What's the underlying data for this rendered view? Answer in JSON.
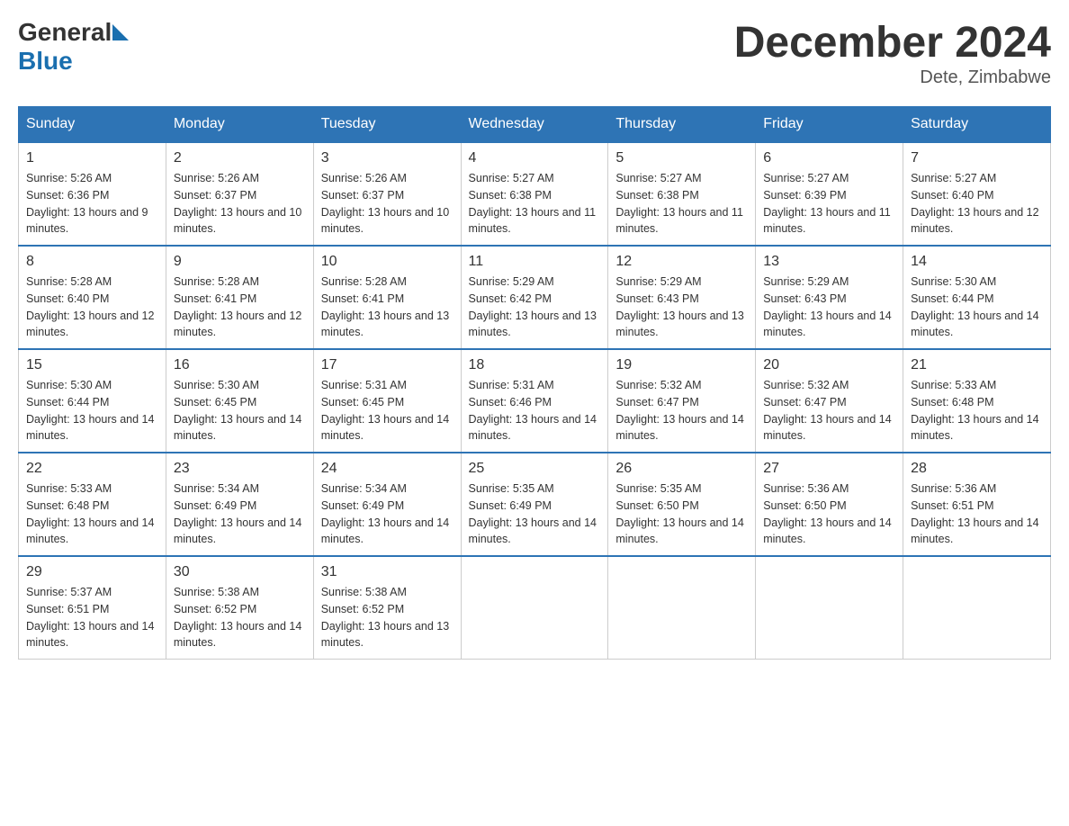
{
  "header": {
    "logo": {
      "general": "General",
      "blue": "Blue"
    },
    "title": "December 2024",
    "subtitle": "Dete, Zimbabwe"
  },
  "calendar": {
    "days_of_week": [
      "Sunday",
      "Monday",
      "Tuesday",
      "Wednesday",
      "Thursday",
      "Friday",
      "Saturday"
    ],
    "weeks": [
      [
        {
          "day": 1,
          "sunrise": "5:26 AM",
          "sunset": "6:36 PM",
          "daylight": "13 hours and 9 minutes."
        },
        {
          "day": 2,
          "sunrise": "5:26 AM",
          "sunset": "6:37 PM",
          "daylight": "13 hours and 10 minutes."
        },
        {
          "day": 3,
          "sunrise": "5:26 AM",
          "sunset": "6:37 PM",
          "daylight": "13 hours and 10 minutes."
        },
        {
          "day": 4,
          "sunrise": "5:27 AM",
          "sunset": "6:38 PM",
          "daylight": "13 hours and 11 minutes."
        },
        {
          "day": 5,
          "sunrise": "5:27 AM",
          "sunset": "6:38 PM",
          "daylight": "13 hours and 11 minutes."
        },
        {
          "day": 6,
          "sunrise": "5:27 AM",
          "sunset": "6:39 PM",
          "daylight": "13 hours and 11 minutes."
        },
        {
          "day": 7,
          "sunrise": "5:27 AM",
          "sunset": "6:40 PM",
          "daylight": "13 hours and 12 minutes."
        }
      ],
      [
        {
          "day": 8,
          "sunrise": "5:28 AM",
          "sunset": "6:40 PM",
          "daylight": "13 hours and 12 minutes."
        },
        {
          "day": 9,
          "sunrise": "5:28 AM",
          "sunset": "6:41 PM",
          "daylight": "13 hours and 12 minutes."
        },
        {
          "day": 10,
          "sunrise": "5:28 AM",
          "sunset": "6:41 PM",
          "daylight": "13 hours and 13 minutes."
        },
        {
          "day": 11,
          "sunrise": "5:29 AM",
          "sunset": "6:42 PM",
          "daylight": "13 hours and 13 minutes."
        },
        {
          "day": 12,
          "sunrise": "5:29 AM",
          "sunset": "6:43 PM",
          "daylight": "13 hours and 13 minutes."
        },
        {
          "day": 13,
          "sunrise": "5:29 AM",
          "sunset": "6:43 PM",
          "daylight": "13 hours and 14 minutes."
        },
        {
          "day": 14,
          "sunrise": "5:30 AM",
          "sunset": "6:44 PM",
          "daylight": "13 hours and 14 minutes."
        }
      ],
      [
        {
          "day": 15,
          "sunrise": "5:30 AM",
          "sunset": "6:44 PM",
          "daylight": "13 hours and 14 minutes."
        },
        {
          "day": 16,
          "sunrise": "5:30 AM",
          "sunset": "6:45 PM",
          "daylight": "13 hours and 14 minutes."
        },
        {
          "day": 17,
          "sunrise": "5:31 AM",
          "sunset": "6:45 PM",
          "daylight": "13 hours and 14 minutes."
        },
        {
          "day": 18,
          "sunrise": "5:31 AM",
          "sunset": "6:46 PM",
          "daylight": "13 hours and 14 minutes."
        },
        {
          "day": 19,
          "sunrise": "5:32 AM",
          "sunset": "6:47 PM",
          "daylight": "13 hours and 14 minutes."
        },
        {
          "day": 20,
          "sunrise": "5:32 AM",
          "sunset": "6:47 PM",
          "daylight": "13 hours and 14 minutes."
        },
        {
          "day": 21,
          "sunrise": "5:33 AM",
          "sunset": "6:48 PM",
          "daylight": "13 hours and 14 minutes."
        }
      ],
      [
        {
          "day": 22,
          "sunrise": "5:33 AM",
          "sunset": "6:48 PM",
          "daylight": "13 hours and 14 minutes."
        },
        {
          "day": 23,
          "sunrise": "5:34 AM",
          "sunset": "6:49 PM",
          "daylight": "13 hours and 14 minutes."
        },
        {
          "day": 24,
          "sunrise": "5:34 AM",
          "sunset": "6:49 PM",
          "daylight": "13 hours and 14 minutes."
        },
        {
          "day": 25,
          "sunrise": "5:35 AM",
          "sunset": "6:49 PM",
          "daylight": "13 hours and 14 minutes."
        },
        {
          "day": 26,
          "sunrise": "5:35 AM",
          "sunset": "6:50 PM",
          "daylight": "13 hours and 14 minutes."
        },
        {
          "day": 27,
          "sunrise": "5:36 AM",
          "sunset": "6:50 PM",
          "daylight": "13 hours and 14 minutes."
        },
        {
          "day": 28,
          "sunrise": "5:36 AM",
          "sunset": "6:51 PM",
          "daylight": "13 hours and 14 minutes."
        }
      ],
      [
        {
          "day": 29,
          "sunrise": "5:37 AM",
          "sunset": "6:51 PM",
          "daylight": "13 hours and 14 minutes."
        },
        {
          "day": 30,
          "sunrise": "5:38 AM",
          "sunset": "6:52 PM",
          "daylight": "13 hours and 14 minutes."
        },
        {
          "day": 31,
          "sunrise": "5:38 AM",
          "sunset": "6:52 PM",
          "daylight": "13 hours and 13 minutes."
        },
        null,
        null,
        null,
        null
      ]
    ]
  }
}
